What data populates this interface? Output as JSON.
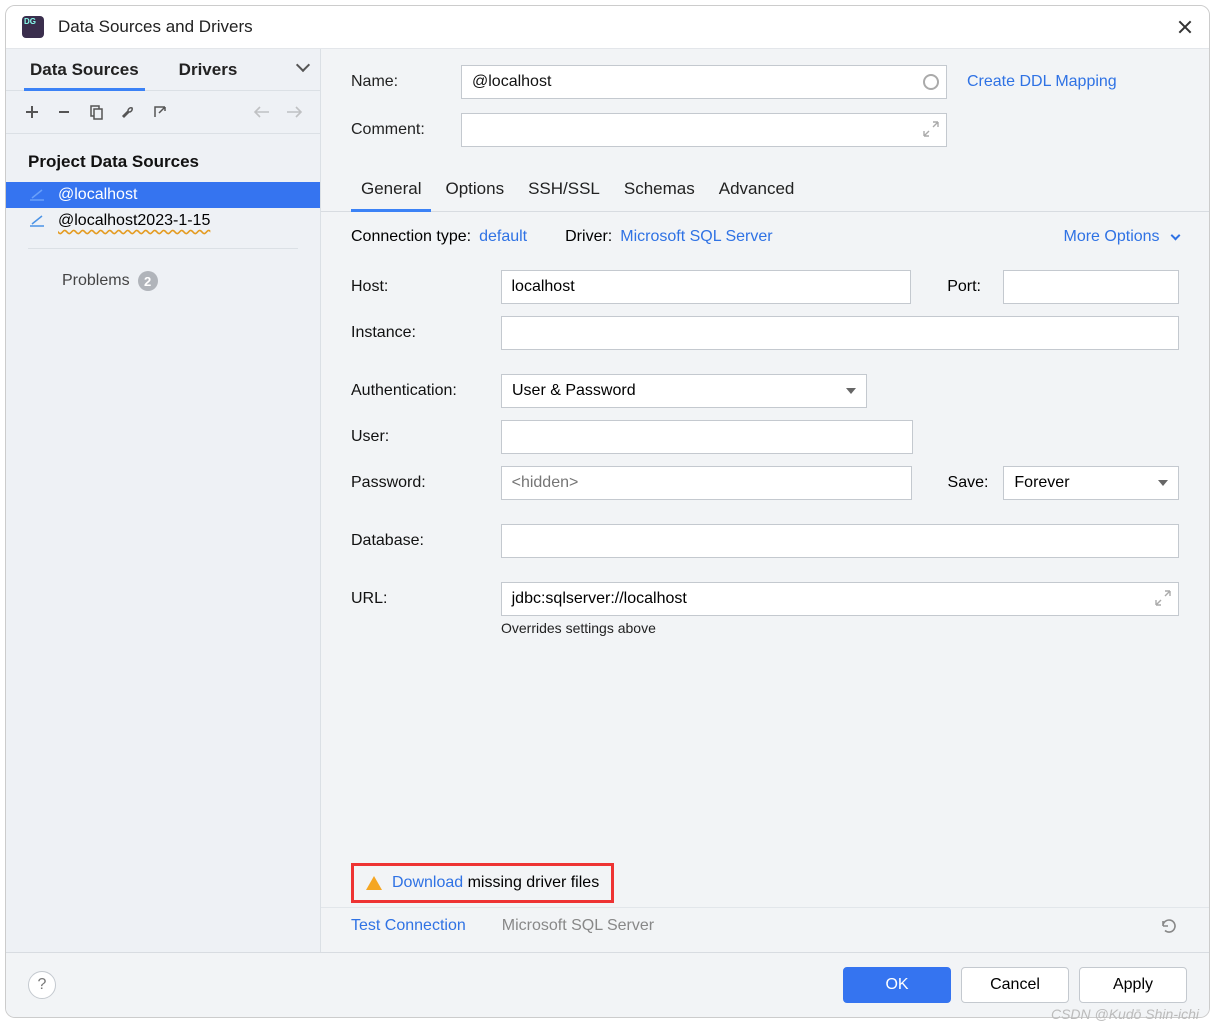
{
  "window": {
    "title": "Data Sources and Drivers"
  },
  "sidebar": {
    "tabs": {
      "data_sources": "Data Sources",
      "drivers": "Drivers"
    },
    "heading": "Project Data Sources",
    "items": [
      {
        "label": "@localhost",
        "selected": true
      },
      {
        "label": "@localhost2023-1-15",
        "selected": false
      }
    ],
    "problems": {
      "label": "Problems",
      "count": "2"
    }
  },
  "form": {
    "name_label": "Name:",
    "name_value": "@localhost",
    "comment_label": "Comment:",
    "create_ddl": "Create DDL Mapping"
  },
  "cfg_tabs": [
    "General",
    "Options",
    "SSH/SSL",
    "Schemas",
    "Advanced"
  ],
  "meta": {
    "conn_type_label": "Connection type:",
    "conn_type_value": "default",
    "driver_label": "Driver:",
    "driver_value": "Microsoft SQL Server",
    "more_options": "More Options"
  },
  "fields": {
    "host_label": "Host:",
    "host_value": "localhost",
    "port_label": "Port:",
    "port_value": "",
    "instance_label": "Instance:",
    "instance_value": "",
    "auth_label": "Authentication:",
    "auth_value": "User & Password",
    "user_label": "User:",
    "user_value": "",
    "password_label": "Password:",
    "password_placeholder": "<hidden>",
    "save_label": "Save:",
    "save_value": "Forever",
    "database_label": "Database:",
    "database_value": "",
    "url_label": "URL:",
    "url_value": "jdbc:sqlserver://localhost",
    "url_hint": "Overrides settings above"
  },
  "warn": {
    "download": "Download",
    "rest": " missing driver files"
  },
  "test": {
    "test_connection": "Test Connection",
    "driver_name": "Microsoft SQL Server"
  },
  "footer": {
    "ok": "OK",
    "cancel": "Cancel",
    "apply": "Apply"
  },
  "watermark": "CSDN @Kudō Shin-ichi"
}
